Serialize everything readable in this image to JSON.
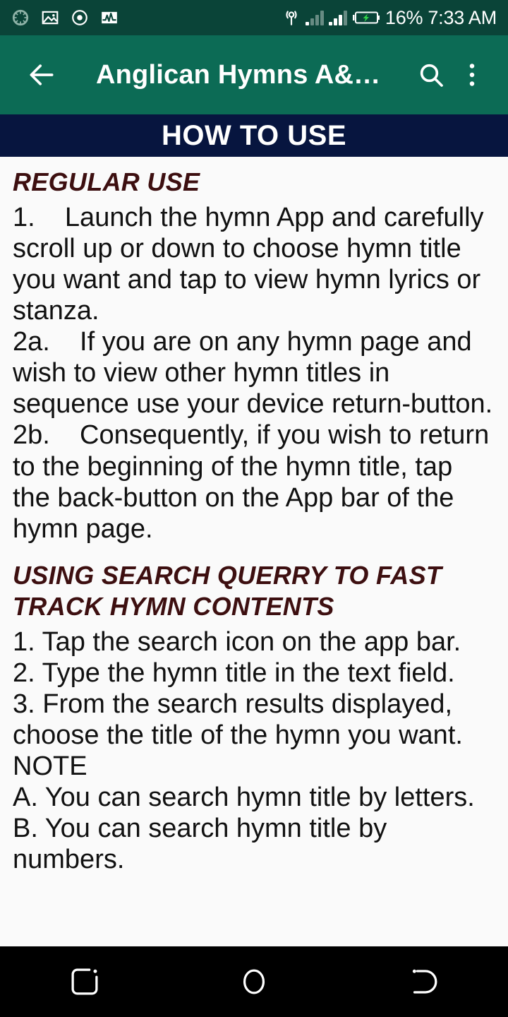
{
  "status_bar": {
    "background": "#0a4438",
    "left_icons": [
      {
        "name": "sync-spinner-icon"
      },
      {
        "name": "screenshot-image-icon"
      },
      {
        "name": "screen-record-icon"
      },
      {
        "name": "data-activity-icon"
      }
    ],
    "right_icons": [
      {
        "name": "hotspot-icon"
      },
      {
        "name": "signal-bars-sim1-icon"
      },
      {
        "name": "signal-bars-sim2-icon"
      },
      {
        "name": "battery-charging-icon"
      }
    ],
    "battery_percent": "16%",
    "clock": "7:33 AM"
  },
  "app_bar": {
    "background": "#0c6b55",
    "back_label": "back-arrow",
    "title": "Anglican Hymns A&…",
    "search_label": "search",
    "overflow_label": "more options"
  },
  "section_banner": {
    "background": "#07153f",
    "title": "HOW TO USE"
  },
  "content": {
    "background": "#fafafa",
    "heading_color": "#3d0f10",
    "body_color": "#111111",
    "heading_1": "REGULAR USE",
    "paragraph_1": "1.    Launch the hymn App and carefully scroll up or down to choose hymn title you want and tap to view hymn lyrics or stanza.",
    "paragraph_2": "2a.    If you are on any hymn page and wish to view other hymn titles in sequence use your device return-button.",
    "paragraph_3": "2b.    Consequently, if you wish to return to the beginning of the hymn title, tap the back-button on the App bar of the hymn page.",
    "heading_2": "USING SEARCH QUERRY TO FAST TRACK HYMN CONTENTS",
    "paragraph_4": "1. Tap the search icon on the app bar.\n2. Type the hymn title in the text field.\n3. From the search results displayed, choose the title of the hymn you want.\nNOTE\nA. You can search hymn title by letters.\nB. You can search hymn title by numbers."
  },
  "nav_bar": {
    "background": "#000000",
    "recents_label": "recent-apps",
    "home_label": "home",
    "back_label": "back"
  }
}
